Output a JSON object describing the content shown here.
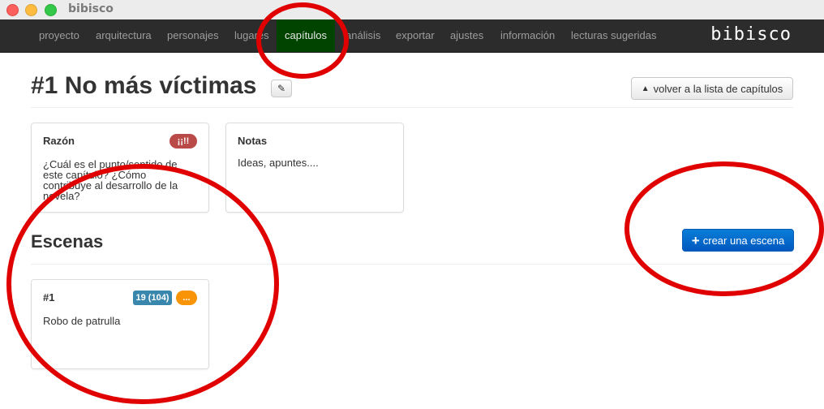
{
  "window": {
    "title": "bibisco"
  },
  "navbar": {
    "items": [
      "proyecto",
      "arquitectura",
      "personajes",
      "lugares",
      "capítulos",
      "análisis",
      "exportar",
      "ajustes",
      "información",
      "lecturas sugeridas"
    ],
    "active": "capítulos",
    "brand": "bibisco"
  },
  "header": {
    "title": "#1 No más víctimas",
    "back_label": "volver a la lista de capítulos"
  },
  "reason_card": {
    "title": "Razón",
    "badge": "¡¡!!",
    "text_lines": [
      "¿Cuál es el punto/sentido de",
      "este capítulo? ¿Cómo",
      "contribuye al desarrollo de la",
      "novela?"
    ]
  },
  "notes_card": {
    "title": "Notas",
    "text": "Ideas, apuntes...."
  },
  "scenes": {
    "title": "Escenas",
    "create_label": "crear una escena",
    "items": [
      {
        "title": "#1",
        "count_badge": "19 (104)",
        "status_badge": "...",
        "text": "Robo de patrulla"
      }
    ]
  },
  "colors": {
    "navbar_bg": "#2c2c2c",
    "active_nav_bg": "#004400",
    "reason_badge": "#b94a48",
    "count_badge": "#3a87ad",
    "status_badge": "#f89406",
    "primary_button": "#0a6fd0",
    "annotation": "#e00000"
  }
}
